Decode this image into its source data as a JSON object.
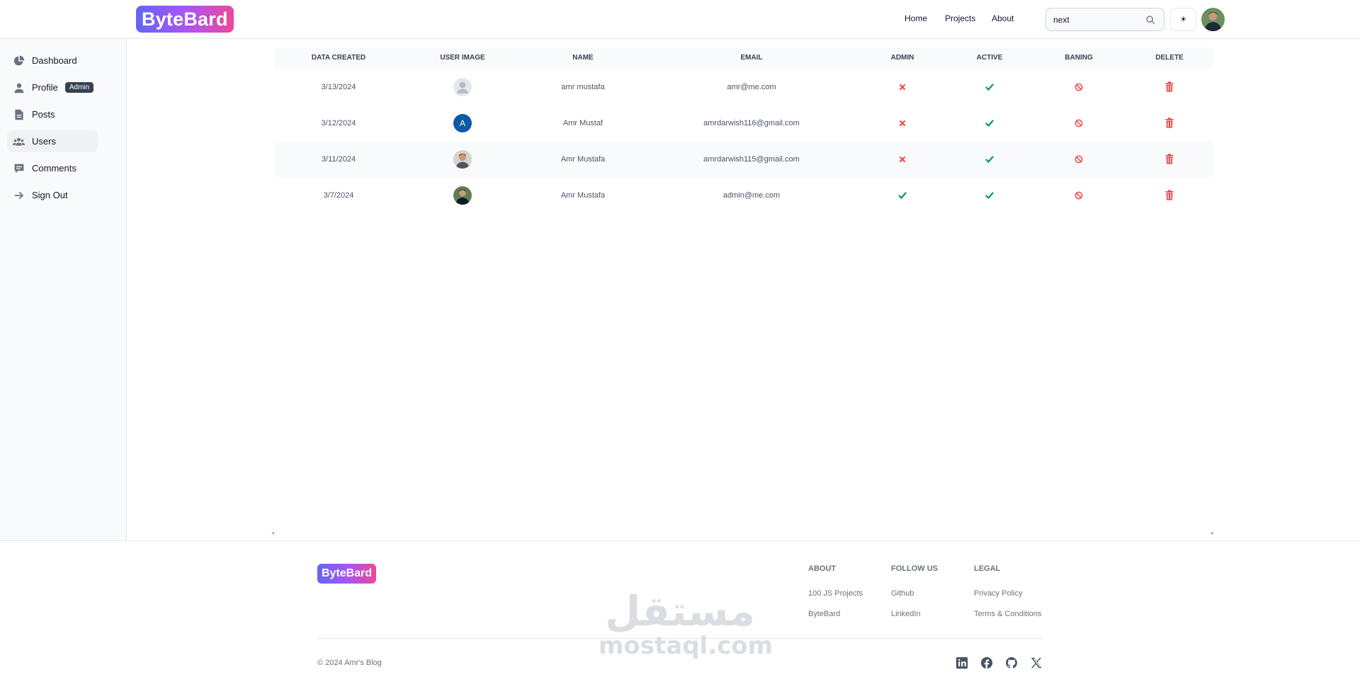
{
  "header": {
    "logo": "ByteBard",
    "nav": [
      "Home",
      "Projects",
      "About"
    ],
    "search_value": "next",
    "theme_toggle": "☀"
  },
  "sidebar": {
    "items": [
      {
        "label": "Dashboard",
        "icon": "pie-chart-icon"
      },
      {
        "label": "Profile",
        "icon": "user-icon",
        "badge": "Admin"
      },
      {
        "label": "Posts",
        "icon": "document-icon"
      },
      {
        "label": "Users",
        "icon": "users-icon",
        "active": true
      },
      {
        "label": "Comments",
        "icon": "comment-icon"
      },
      {
        "label": "Sign Out",
        "icon": "arrow-right-icon"
      }
    ]
  },
  "table": {
    "headers": [
      "DATA CREATED",
      "USER IMAGE",
      "NAME",
      "EMAIL",
      "ADMIN",
      "ACTIVE",
      "BANING",
      "DELETE"
    ],
    "rows": [
      {
        "date": "3/13/2024",
        "avatar": "default",
        "name": "amr mustafa",
        "email": "amr@me.com",
        "admin": false,
        "active": true
      },
      {
        "date": "3/12/2024",
        "avatar": "letter",
        "avatar_letter": "A",
        "name": "Amr Mustaf",
        "email": "amrdarwish116@gmail.com",
        "admin": false,
        "active": true
      },
      {
        "date": "3/11/2024",
        "avatar": "photo",
        "name": "Amr Mustafa",
        "email": "amrdarwish115@gmail.com",
        "admin": false,
        "active": true
      },
      {
        "date": "3/7/2024",
        "avatar": "photo-dark",
        "name": "Amr Mustafa",
        "email": "admin@me.com",
        "admin": true,
        "active": true
      }
    ]
  },
  "footer": {
    "logo": "ByteBard",
    "columns": [
      {
        "title": "ABOUT",
        "links": [
          "100 JS Projects",
          "ByteBard"
        ]
      },
      {
        "title": "FOLLOW US",
        "links": [
          "Github",
          "LinkedIn"
        ]
      },
      {
        "title": "LEGAL",
        "links": [
          "Privacy Policy",
          "Terms & Conditions"
        ]
      }
    ],
    "copyright": "© 2024 Amr's Blog",
    "social": [
      "linkedin-icon",
      "facebook-icon",
      "github-icon",
      "x-icon"
    ]
  },
  "watermark": {
    "arabic": "مستقل",
    "latin": "mostaql.com"
  },
  "colors": {
    "accent_start": "#6366f1",
    "accent_end": "#ec4899",
    "check": "#059669",
    "cross": "#ef4444",
    "ban": "#ef4444"
  }
}
